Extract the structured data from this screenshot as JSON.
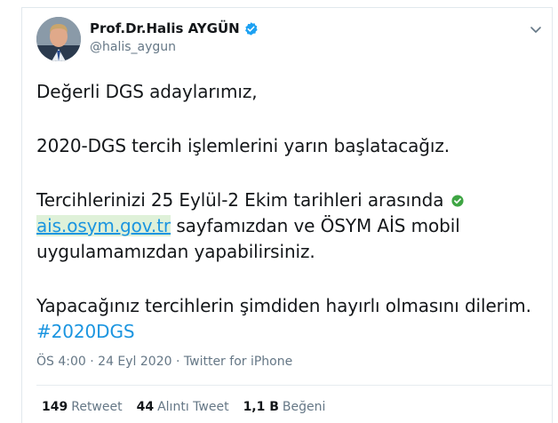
{
  "user": {
    "display_name": "Prof.Dr.Halis AYGÜN",
    "handle": "@halis_aygun"
  },
  "tweet": {
    "line1": "Değerli DGS adaylarımız,",
    "line2": "2020-DGS tercih işlemlerini yarın başlatacağız.",
    "line3_pre": "Tercihlerinizi 25 Eylül-2 Ekim tarihleri arasında",
    "link": "ais.osym.gov.tr",
    "line3_post": " sayfamızdan ve ÖSYM AİS mobil uygulamamızdan yapabilirsiniz.",
    "line4": "Yapacağınız tercihlerin şimdiden hayırlı olmasını dilerim.",
    "hashtag": "#2020DGS"
  },
  "meta": {
    "time": "ÖS 4:00",
    "date": "24 Eyl 2020",
    "source": "Twitter for iPhone",
    "sep": "·"
  },
  "stats": {
    "retweets_count": "149",
    "retweets_label": "Retweet",
    "quotes_count": "44",
    "quotes_label": "Alıntı Tweet",
    "likes_count": "1,1 B",
    "likes_label": "Beğeni"
  },
  "colors": {
    "link": "#1b95e0",
    "verified": "#1da1f2",
    "secondary_text": "#657786",
    "check_emoji": "#3ea543"
  }
}
